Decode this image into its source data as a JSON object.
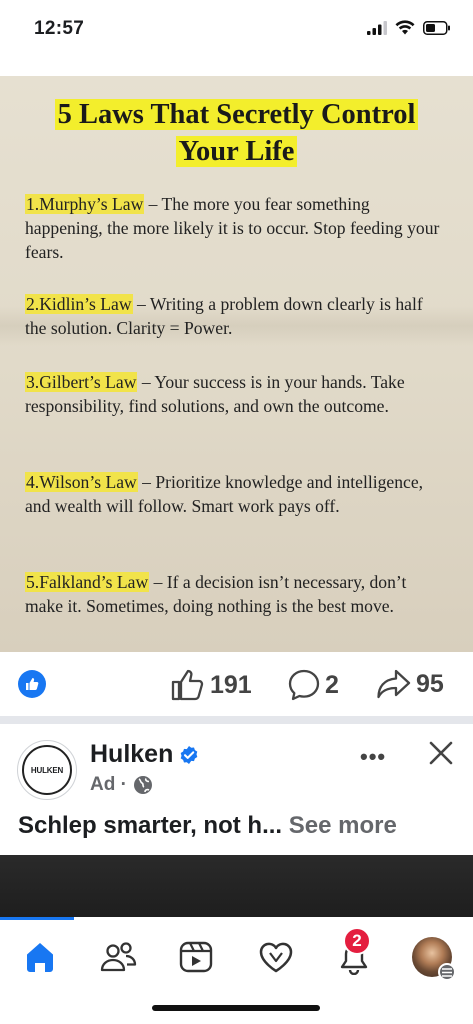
{
  "status_bar": {
    "time": "12:57"
  },
  "post_image": {
    "title_line1": "5 Laws That Secretly Control",
    "title_line2": "Your Life",
    "laws": [
      {
        "name": "1.Murphy’s Law",
        "text": " – The more you fear something happening, the more likely it is to occur. Stop feeding your fears."
      },
      {
        "name": "2.Kidlin’s Law",
        "text": " – Writing a problem down clearly is half the solution. Clarity = Power."
      },
      {
        "name": "3.Gilbert’s Law",
        "text": " – Your success is in your hands. Take responsibility, find solutions, and own the outcome."
      },
      {
        "name": "4.Wilson’s Law",
        "text": " – Prioritize knowledge and intelligence, and wealth will follow. Smart work pays off."
      },
      {
        "name": "5.Falkland’s Law",
        "text": " – If a decision isn’t necessary, don’t make it. Sometimes, doing nothing is the best move."
      }
    ]
  },
  "reactions": {
    "likes": "191",
    "comments": "2",
    "shares": "95"
  },
  "ad": {
    "logo_text": "HULKEN",
    "advertiser": "Hulken",
    "label": "Ad ·",
    "more": "•••",
    "text": "Schlep smarter, not h...",
    "see_more": "See more"
  },
  "bottom_nav": {
    "notifications_badge": "2"
  },
  "colors": {
    "accent": "#1877f2",
    "highlight": "#f3ee2c",
    "badge": "#e41e3f"
  }
}
